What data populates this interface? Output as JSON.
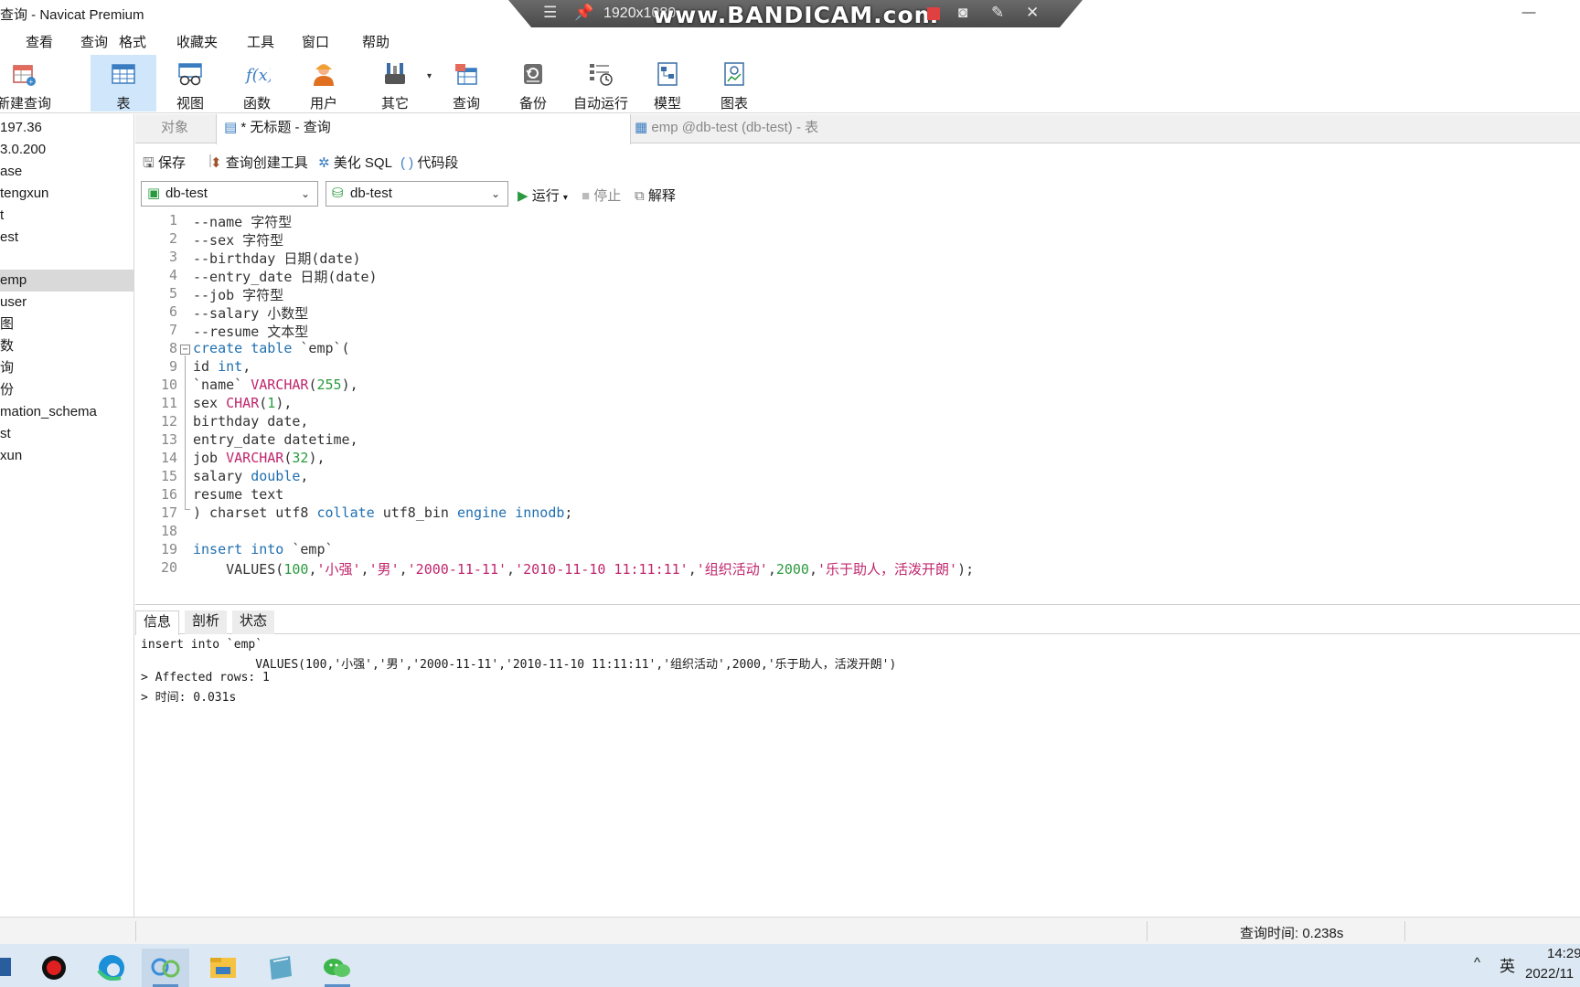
{
  "window": {
    "title": "查询 - Navicat Premium",
    "minimize_glyph": "—"
  },
  "recorder_overlay": {
    "resolution": "1920x1080",
    "logo": "www.BANDICAM.com"
  },
  "menu": [
    "查看",
    "查询",
    "格式",
    "收藏夹",
    "工具",
    "窗口",
    "帮助"
  ],
  "toolbar": [
    {
      "label": "新建查询",
      "icon": "new-query-icon"
    },
    {
      "label": "表",
      "icon": "table-icon",
      "active": true
    },
    {
      "label": "视图",
      "icon": "view-icon"
    },
    {
      "label": "函数",
      "icon": "function-icon"
    },
    {
      "label": "用户",
      "icon": "user-icon"
    },
    {
      "label": "其它",
      "icon": "tools-icon"
    },
    {
      "label": "查询",
      "icon": "query-icon"
    },
    {
      "label": "备份",
      "icon": "backup-icon"
    },
    {
      "label": "自动运行",
      "icon": "schedule-icon"
    },
    {
      "label": "模型",
      "icon": "model-icon"
    },
    {
      "label": "图表",
      "icon": "chart-icon"
    }
  ],
  "sidebar": [
    "197.36",
    "3.0.200",
    "ase",
    "tengxun",
    "t",
    "est",
    "",
    "emp",
    "user",
    "图",
    "数",
    "询",
    "份",
    "mation_schema",
    "st",
    "xun"
  ],
  "sidebar_selected": "emp",
  "tabs": {
    "objects": "对象",
    "active": "* 无标题 - 查询",
    "table": "emp @db-test (db-test) - 表"
  },
  "query_toolbar": {
    "save": "保存",
    "builder": "查询创建工具",
    "beautify": "美化 SQL",
    "snippet": "代码段"
  },
  "connection_select": "db-test",
  "database_select": "db-test",
  "run": {
    "run": "运行",
    "stop": "停止",
    "explain": "解释"
  },
  "editor_lines": [
    "1",
    "2",
    "3",
    "4",
    "5",
    "6",
    "7",
    "8",
    "9",
    "10",
    "11",
    "12",
    "13",
    "14",
    "15",
    "16",
    "17",
    "18",
    "19",
    "20"
  ],
  "bottom_tabs": [
    "信息",
    "剖析",
    "状态"
  ],
  "output": {
    "line1": "insert into `emp`",
    "line2": "                VALUES(100,'小强','男','2000-11-11','2010-11-10 11:11:11','组织活动',2000,'乐于助人，活泼开朗')",
    "line3": "> Affected rows: 1",
    "line4": "> 时间: 0.031s"
  },
  "status": {
    "query_time": "查询时间: 0.238s"
  },
  "tray": {
    "chevron": "^",
    "ime": "英",
    "time": "14:29",
    "date": "2022/11"
  }
}
